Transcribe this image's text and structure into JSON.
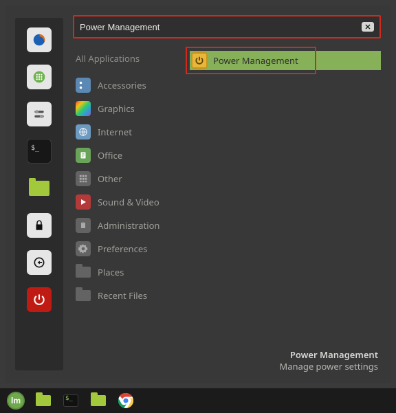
{
  "search": {
    "value": "Power Management"
  },
  "favorites": [
    {
      "name": "firefox",
      "bg": "#e6e6e6",
      "glyph": "firefox"
    },
    {
      "name": "apps-grid",
      "bg": "#e6e6e6",
      "glyph": "grid-green"
    },
    {
      "name": "system-settings",
      "bg": "#e6e6e6",
      "glyph": "toggles"
    },
    {
      "name": "terminal",
      "bg": "#171717",
      "glyph": "terminal"
    },
    {
      "name": "file-manager",
      "bg": "transparent",
      "glyph": "folder-green"
    },
    {
      "name": "lock",
      "bg": "#e6e6e6",
      "glyph": "lock"
    },
    {
      "name": "logout",
      "bg": "#e6e6e6",
      "glyph": "logout"
    },
    {
      "name": "power",
      "bg": "#c01b12",
      "glyph": "power"
    }
  ],
  "categories_header": "All Applications",
  "categories": [
    {
      "name": "accessories",
      "label": "Accessories",
      "icon": "scissors",
      "bg": "#5b89b3"
    },
    {
      "name": "graphics",
      "label": "Graphics",
      "icon": "rainbow",
      "bg": "multi"
    },
    {
      "name": "internet",
      "label": "Internet",
      "icon": "globe",
      "bg": "#6d9ac0"
    },
    {
      "name": "office",
      "label": "Office",
      "icon": "doc",
      "bg": "#6aa35a"
    },
    {
      "name": "other",
      "label": "Other",
      "icon": "grid",
      "bg": "#636363"
    },
    {
      "name": "sound-video",
      "label": "Sound & Video",
      "icon": "play",
      "bg": "#b43a3a"
    },
    {
      "name": "administration",
      "label": "Administration",
      "icon": "clipboard",
      "bg": "#636363"
    },
    {
      "name": "preferences",
      "label": "Preferences",
      "icon": "gear",
      "bg": "#636363"
    },
    {
      "name": "places",
      "label": "Places",
      "icon": "folder",
      "bg": "#636363"
    },
    {
      "name": "recent-files",
      "label": "Recent Files",
      "icon": "folder",
      "bg": "#636363"
    }
  ],
  "result": {
    "label": "Power Management"
  },
  "tooltip": {
    "title": "Power Management",
    "desc": "Manage power settings"
  },
  "taskbar": [
    {
      "name": "menu-button",
      "glyph": "mint"
    },
    {
      "name": "show-desktop",
      "glyph": "folder-green-small"
    },
    {
      "name": "terminal-app",
      "glyph": "terminal"
    },
    {
      "name": "files-app",
      "glyph": "folder-green-small"
    },
    {
      "name": "chrome-app",
      "glyph": "chrome"
    }
  ]
}
